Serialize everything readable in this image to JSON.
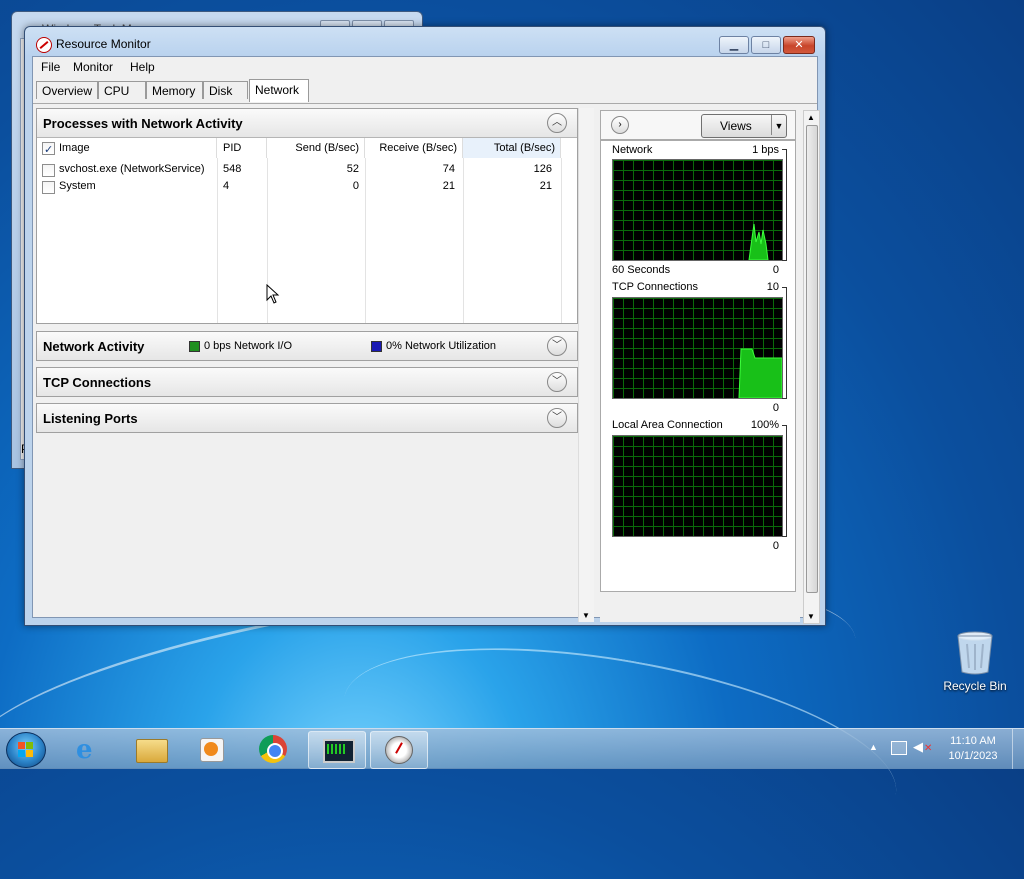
{
  "background_window": {
    "title": "Windows Task Manager",
    "footer_fragment": "P"
  },
  "window": {
    "title": "Resource Monitor",
    "menu": [
      "File",
      "Monitor",
      "Help"
    ],
    "tabs": [
      {
        "label": "Overview",
        "active": false
      },
      {
        "label": "CPU",
        "active": false
      },
      {
        "label": "Memory",
        "active": false
      },
      {
        "label": "Disk",
        "active": false
      },
      {
        "label": "Network",
        "active": true
      }
    ],
    "processes_panel": {
      "title": "Processes with Network Activity",
      "columns": [
        "Image",
        "PID",
        "Send (B/sec)",
        "Receive (B/sec)",
        "Total (B/sec)"
      ],
      "rows": [
        {
          "image": "svchost.exe (NetworkService)",
          "pid": "548",
          "send": "52",
          "receive": "74",
          "total": "126"
        },
        {
          "image": "System",
          "pid": "4",
          "send": "0",
          "receive": "21",
          "total": "21"
        }
      ]
    },
    "network_activity_panel": {
      "title": "Network Activity",
      "legend1": "0 bps Network I/O",
      "legend1_color": "#1f8f1f",
      "legend2": "0% Network Utilization",
      "legend2_color": "#1a1ab4"
    },
    "tcp_panel": {
      "title": "TCP Connections"
    },
    "ports_panel": {
      "title": "Listening Ports"
    },
    "right": {
      "views_label": "Views",
      "graphs": [
        {
          "title": "Network",
          "max": "1 bps",
          "footer_left": "60 Seconds",
          "footer_right": "0"
        },
        {
          "title": "TCP Connections",
          "max": "10",
          "footer_right": "0"
        },
        {
          "title": "Local Area Connection",
          "max": "100%",
          "footer_right": "0"
        }
      ]
    }
  },
  "desktop": {
    "recycle_bin": "Recycle Bin"
  },
  "taskbar": {
    "time": "11:10 AM",
    "date": "10/1/2023"
  }
}
